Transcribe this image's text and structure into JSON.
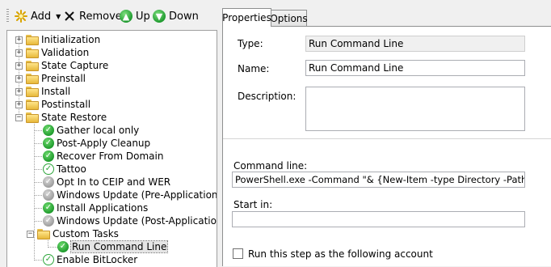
{
  "toolbar": {
    "add_label": "Add",
    "remove_label": "Remove",
    "up_label": "Up",
    "down_label": "Down",
    "icons": {
      "add": "star-burst-icon",
      "remove": "x-icon",
      "up": "up-arrow-circle-icon",
      "down": "down-arrow-circle-icon"
    }
  },
  "tree": {
    "groups": [
      {
        "label": "Initialization"
      },
      {
        "label": "Validation"
      },
      {
        "label": "State Capture"
      },
      {
        "label": "Preinstall"
      },
      {
        "label": "Install"
      },
      {
        "label": "Postinstall"
      },
      {
        "label": "State Restore"
      }
    ],
    "children": [
      {
        "label": "Gather local only",
        "status": "green"
      },
      {
        "label": "Post-Apply Cleanup",
        "status": "green"
      },
      {
        "label": "Recover From Domain",
        "status": "green"
      },
      {
        "label": "Tattoo",
        "status": "white"
      },
      {
        "label": "Opt In to CEIP and WER",
        "status": "grey"
      },
      {
        "label": "Windows Update (Pre-Application Installa",
        "status": "grey"
      },
      {
        "label": "Install Applications",
        "status": "green"
      },
      {
        "label": "Windows Update (Post-Application Installa",
        "status": "grey"
      },
      {
        "label": "Custom Tasks",
        "status": "folder"
      },
      {
        "label": "Run Command Line",
        "status": "green"
      },
      {
        "label": "Enable BitLocker",
        "status": "white"
      }
    ]
  },
  "tabs": {
    "properties": "Properties",
    "options": "Options"
  },
  "form": {
    "type_label": "Type:",
    "type_value": "Run Command Line",
    "name_label": "Name:",
    "name_value": "Run Command Line",
    "description_label": "Description:",
    "description_value": "",
    "command_line_label": "Command line:",
    "command_line_value": "PowerShell.exe -Command \"& {New-Item -type Directory -Path C:\\Files}\"",
    "start_in_label": "Start in:",
    "start_in_value": "",
    "run_as_label": "Run this step as the following account"
  },
  "colors": {
    "success": "#1e9a2c",
    "selection": "#e5e5e5",
    "folder": "#e7b83a"
  }
}
